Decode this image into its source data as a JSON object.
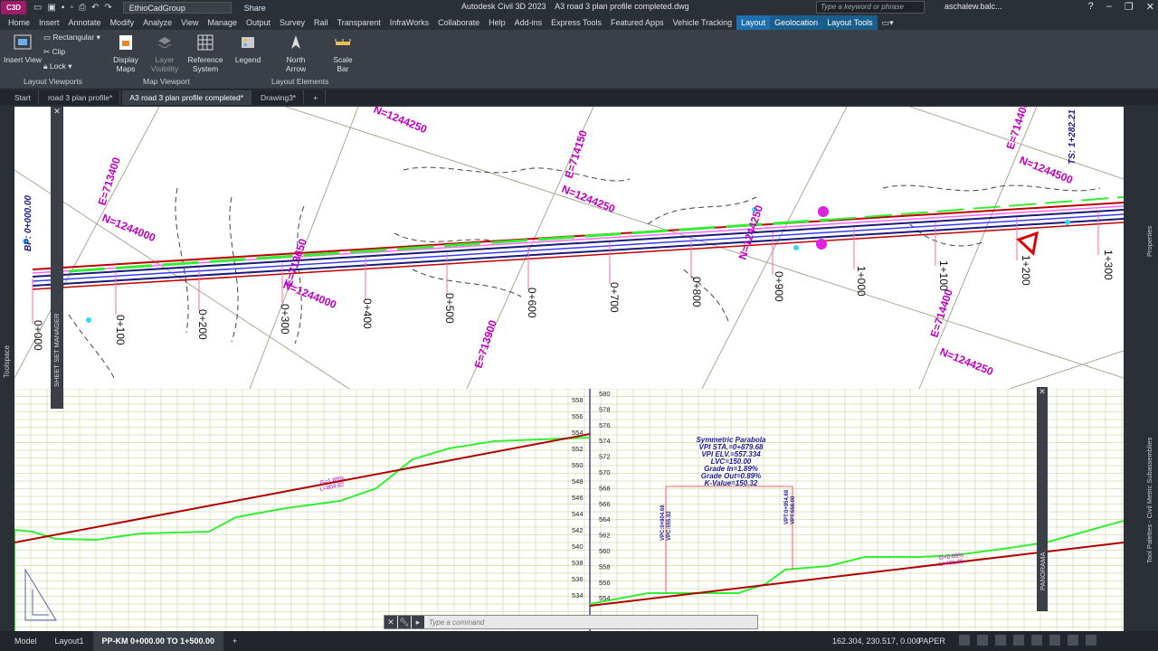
{
  "titlebar": {
    "logo": "C3D",
    "workspace": "EthioCadGroup",
    "share": "Share",
    "app_title": "Autodesk Civil 3D 2023",
    "file_title": "A3 road 3 plan profile completed.dwg",
    "search_placeholder": "Type a keyword or phrase",
    "user": "aschalew.balc..."
  },
  "menu": [
    "Home",
    "Insert",
    "Annotate",
    "Modify",
    "Analyze",
    "View",
    "Manage",
    "Output",
    "Survey",
    "Rail",
    "Transparent",
    "InfraWorks",
    "Collaborate",
    "Help",
    "Add-ins",
    "Express Tools",
    "Featured Apps",
    "Vehicle Tracking",
    "Layout",
    "Geolocation",
    "Layout Tools"
  ],
  "ribbon": {
    "insert_view": "Insert View",
    "rectangular": "Rectangular",
    "clip": "Clip",
    "lock": "Lock",
    "layout_viewports": "Layout Viewports",
    "display_maps": "Display Maps",
    "layer_visibility": "Layer Visibility",
    "reference_system": "Reference System",
    "map_viewport": "Map Viewport",
    "legend": "Legend",
    "north_arrow": "North Arrow",
    "scale_bar": "Scale Bar",
    "layout_elements": "Layout Elements"
  },
  "file_tabs": [
    "Start",
    "road 3 plan profile*",
    "A3 road 3 plan profile completed*",
    "Drawing3*"
  ],
  "panels": {
    "toolspace": "Toolspace",
    "sheet_set_manager": "SHEET SET MANAGER",
    "panorama": "PANORAMA",
    "properties": "Properties",
    "tool_palettes": "Tool Palettes - Civil Metric Subassemblies"
  },
  "plan": {
    "bp": "BP: 0+000.00",
    "ts": "TS: 1+282.21",
    "grid_labels": [
      "E=713400",
      "N=1244000",
      "N=1244250",
      "E=713650",
      "N=1244000",
      "E=713900",
      "N=1244250",
      "E=714150",
      "N=1244250",
      "N=1244500",
      "E=714400",
      "N=1244250",
      "E=714400"
    ],
    "stations": [
      "0+000",
      "0+100",
      "0+200",
      "0+300",
      "0+400",
      "0+500",
      "0+600",
      "0+700",
      "0+800",
      "0+900",
      "1+000",
      "1+100",
      "1+200",
      "1+300"
    ]
  },
  "profile": {
    "left_axis": [
      "558",
      "556",
      "554",
      "552",
      "550",
      "548",
      "546",
      "544",
      "542",
      "540",
      "538",
      "536",
      "534"
    ],
    "right_axis": [
      "580",
      "578",
      "576",
      "574",
      "572",
      "570",
      "568",
      "566",
      "564",
      "562",
      "560",
      "558",
      "556",
      "554"
    ],
    "vc_lines": [
      "Symmetric Parabola",
      "VPI STA.=0+879.68",
      "VPI ELV.=557.334",
      "LVC=150.00",
      "Grade In=1.89%",
      "Grade Out=0.89%",
      "K-Value=150.32"
    ],
    "grade1": "G=1.89%",
    "grade1_len": "L=804.82",
    "grade2": "G=0.89%",
    "grade2_len": "L=401.39",
    "vpc": "VPC:0+804.68",
    "vpc_elv": "VPC:555.92",
    "vpt": "VPT:0+954.68",
    "vpt_elv": "VPT:558.00"
  },
  "command": {
    "placeholder": "Type a command"
  },
  "status": {
    "tabs": [
      "Model",
      "Layout1",
      "PP-KM 0+000.00 TO 1+500.00"
    ],
    "coords": "162.304, 230.517, 0.000",
    "paper": "PAPER"
  },
  "colors": {
    "accent": "#1d6fb0",
    "grid_label": "#c000c0",
    "profile_grade": "#b00000",
    "profile_ground": "#33ee33"
  }
}
